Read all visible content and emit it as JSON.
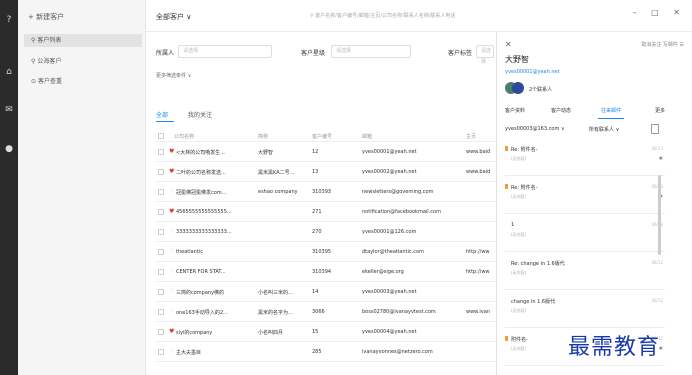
{
  "sidebar": {
    "new_customer": "+ 新建客户",
    "items": [
      {
        "label": "客户列表",
        "icon": "user-icon"
      },
      {
        "label": "公海客户",
        "icon": "users-icon"
      },
      {
        "label": "客户查重",
        "icon": "search-icon"
      }
    ]
  },
  "topbar": {
    "title": "全部客户 ∨",
    "search_placeholder": "客户名称/客户编号/邮箱/主页/公司名称/联系人名称/联系人电话"
  },
  "filters": {
    "owner_label": "所属人",
    "owner_placeholder": "请选择",
    "level_label": "客户星级",
    "level_placeholder": "请选择",
    "tag_label": "客户标签",
    "tag_placeholder": "请选择",
    "more": "更多筛选条件 ∨"
  },
  "tabs": [
    {
      "label": "全部",
      "active": true
    },
    {
      "label": "我的关注",
      "active": false
    }
  ],
  "table": {
    "columns": [
      "公司名称",
      "简称",
      "客户编号",
      "邮箱",
      "主页"
    ],
    "rows": [
      {
        "heart": true,
        "name": "<大林的公司哦发生...",
        "short": "大野智",
        "id": "12",
        "email": "yves00001@yeah.net",
        "home": "www.baid"
      },
      {
        "heart": true,
        "name": "二叶的公司名称发送...",
        "short": "黑米黑KA二号...",
        "id": "13",
        "email": "yves00002@yeah.net",
        "home": "www.baid"
      },
      {
        "heart": false,
        "name": "冠冕佛冠冕佛发com...",
        "short": "eshao company",
        "id": "310393",
        "email": "newsletters@governing.com",
        "home": ""
      },
      {
        "heart": true,
        "name": "4565555555555555...",
        "short": "",
        "id": "271",
        "email": "notification@facebookmail.com",
        "home": ""
      },
      {
        "heart": false,
        "name": "3333333333333333...",
        "short": "",
        "id": "270",
        "email": "yves00001@126.com",
        "home": ""
      },
      {
        "heart": false,
        "name": "theatlantic",
        "short": "",
        "id": "310395",
        "email": "dtaylor@theatlantic.com",
        "home": "http://ww"
      },
      {
        "heart": false,
        "name": "CENTER FOR STAT...",
        "short": "",
        "id": "310394",
        "email": "ekeller@sige.org",
        "home": "http://ww"
      },
      {
        "heart": false,
        "name": "三简的company佛的",
        "short": "小名叫三米的...",
        "id": "14",
        "email": "yves00003@yeah.net",
        "home": ""
      },
      {
        "heart": false,
        "name": "one163手动导入的2...",
        "short": "黑米的名字为...",
        "id": "3066",
        "email": "boss02780@ivanayvtest.com",
        "home": "www.ivan"
      },
      {
        "heart": true,
        "name": "siyi的company",
        "short": "小名叫四月",
        "id": "15",
        "email": "yves00004@yeah.net",
        "home": ""
      },
      {
        "heart": false,
        "name": "主大夫墨目",
        "short": "",
        "id": "285",
        "email": "ivanayvonnes@netzero.com",
        "home": ""
      }
    ]
  },
  "panel": {
    "actions": "取消关注  写邮件",
    "name": "大野智",
    "email": "yves00001@yeah.net",
    "contact_count": "2个联系人",
    "tabs": [
      "客户资料",
      "客户动态",
      "往来邮件",
      "更多"
    ],
    "filter_from": "yves00003@163.com ∨",
    "filter_contacts": "所有联系人 ∨",
    "mails": [
      {
        "subject": "Re: 附件名-",
        "body": "(无内容)",
        "date": "06/13",
        "flag": true
      },
      {
        "subject": "Re: 附件名-",
        "body": "(无内容)",
        "date": "06/13",
        "flag": true
      },
      {
        "subject": "1",
        "body": "(无内容)",
        "date": "06/13",
        "flag": false
      },
      {
        "subject": "Re: change in 1.6版代",
        "body": "(无内容)",
        "date": "06/12",
        "flag": false
      },
      {
        "subject": "change in 1.6版代",
        "body": "(无内容)",
        "date": "06/12",
        "flag": false
      },
      {
        "subject": "附件名-",
        "body": "(无内容)",
        "date": "06/12",
        "flag": true
      }
    ]
  },
  "watermark": "最需教育",
  "colors": {
    "accent": "#1e88e5",
    "heart": "#e53935",
    "rail": "#2b2b2b"
  }
}
